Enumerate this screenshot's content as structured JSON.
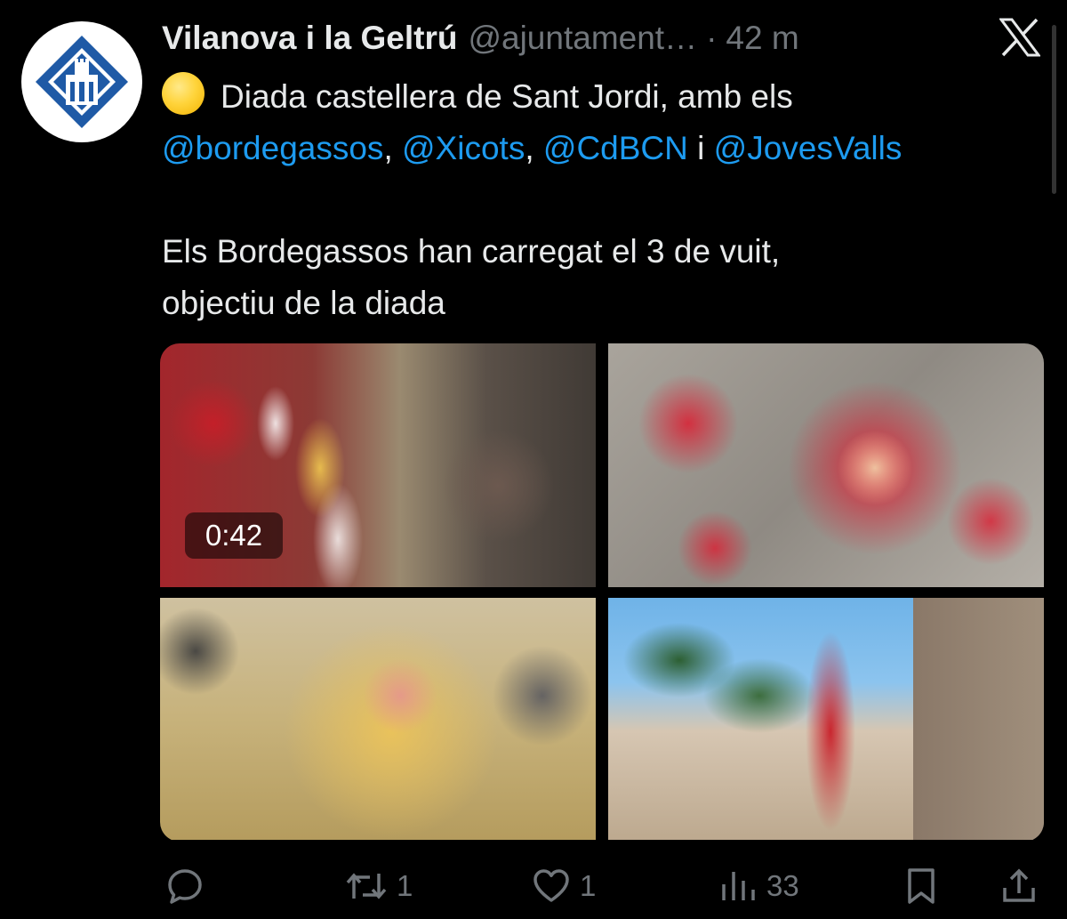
{
  "tweet": {
    "author_name": "Vilanova i la Geltrú",
    "handle": "@ajuntament…",
    "separator": "·",
    "time": "42 m",
    "line1_text": "Diada castellera de Sant Jordi, amb els",
    "mentions": [
      "@bordegassos",
      "@Xicots",
      "@CdBCN",
      "@JovesValls"
    ],
    "comma": ",",
    "conjunction": "i",
    "para2_line1": "Els Bordegassos han carregat el 3 de vuit,",
    "para2_line2": "objectiu de la diada",
    "emoji": "yellow-circle-emoji"
  },
  "media": {
    "video_duration": "0:42",
    "items": [
      {
        "name": "video-castell-closeup"
      },
      {
        "name": "photo-red-shirts-aerial"
      },
      {
        "name": "photo-yellow-shirts-aerial"
      },
      {
        "name": "photo-red-castell-plaza"
      }
    ]
  },
  "actions": {
    "reply_count": "",
    "retweet_count": "1",
    "like_count": "1",
    "views_count": "33"
  },
  "colors": {
    "background": "#000000",
    "text": "#e7e9ea",
    "muted": "#71767b",
    "link": "#1d9bf0",
    "logo_blue": "#1f5aa6"
  }
}
